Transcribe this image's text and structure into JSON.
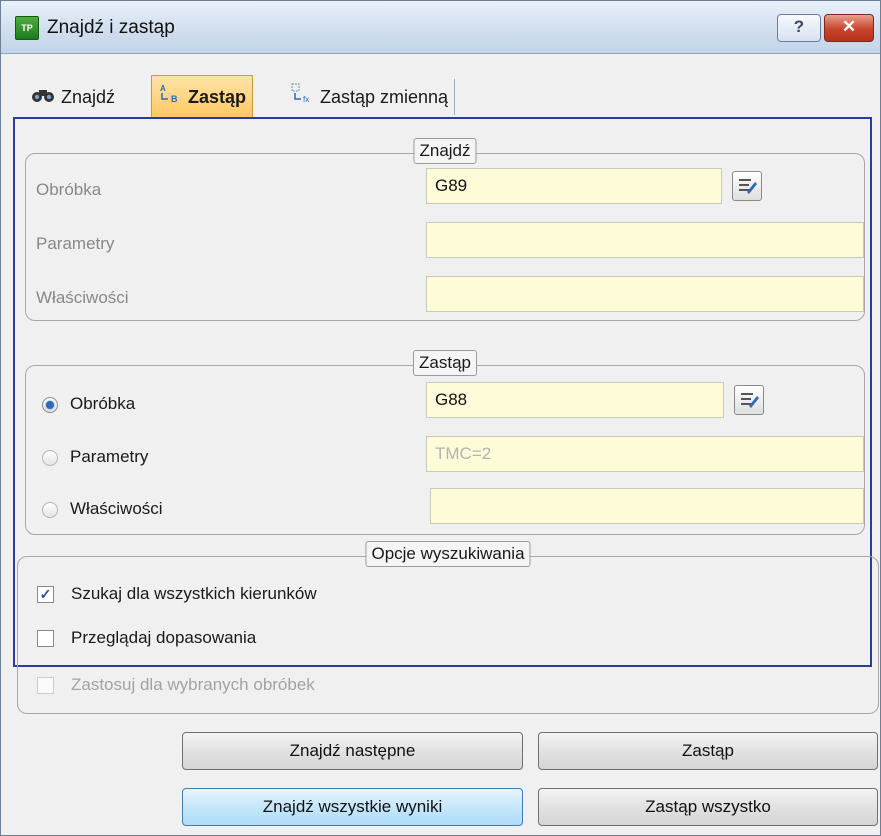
{
  "window": {
    "title": "Znajdź i zastąp",
    "help_label": "?",
    "close_label": "✕"
  },
  "tabs": [
    {
      "label": "Znajdź",
      "icon": "binoculars-icon",
      "active": false
    },
    {
      "label": "Zastąp",
      "icon": "replace-icon",
      "active": true
    },
    {
      "label": "Zastąp zmienną",
      "icon": "replace-variable-icon",
      "active": false
    }
  ],
  "find": {
    "legend": "Znajdź",
    "rows": [
      {
        "label": "Obróbka",
        "value": "G89"
      },
      {
        "label": "Parametry",
        "value": ""
      },
      {
        "label": "Właściwości",
        "value": ""
      }
    ]
  },
  "replace": {
    "legend": "Zastąp",
    "rows": [
      {
        "label": "Obróbka",
        "value": "G88",
        "selected": true
      },
      {
        "label": "Parametry",
        "value": "",
        "placeholder": "TMC=2",
        "selected": false
      },
      {
        "label": "Właściwości",
        "value": "",
        "selected": false
      }
    ]
  },
  "options": {
    "legend": "Opcje wyszukiwania",
    "items": [
      {
        "label": "Szukaj dla wszystkich kierunków",
        "checked": true,
        "enabled": true
      },
      {
        "label": "Przeglądaj dopasowania",
        "checked": false,
        "enabled": true
      },
      {
        "label": "Zastosuj dla wybranych obróbek",
        "checked": false,
        "enabled": false
      }
    ]
  },
  "buttons": {
    "find_next": "Znajdź następne",
    "replace": "Zastąp",
    "find_all": "Znajdź wszystkie wyniki",
    "replace_all": "Zastąp wszystko"
  },
  "colors": {
    "field_bg": "#fefbd8",
    "active_tab": "#ffc860",
    "panel_border": "#2a3aa6"
  }
}
